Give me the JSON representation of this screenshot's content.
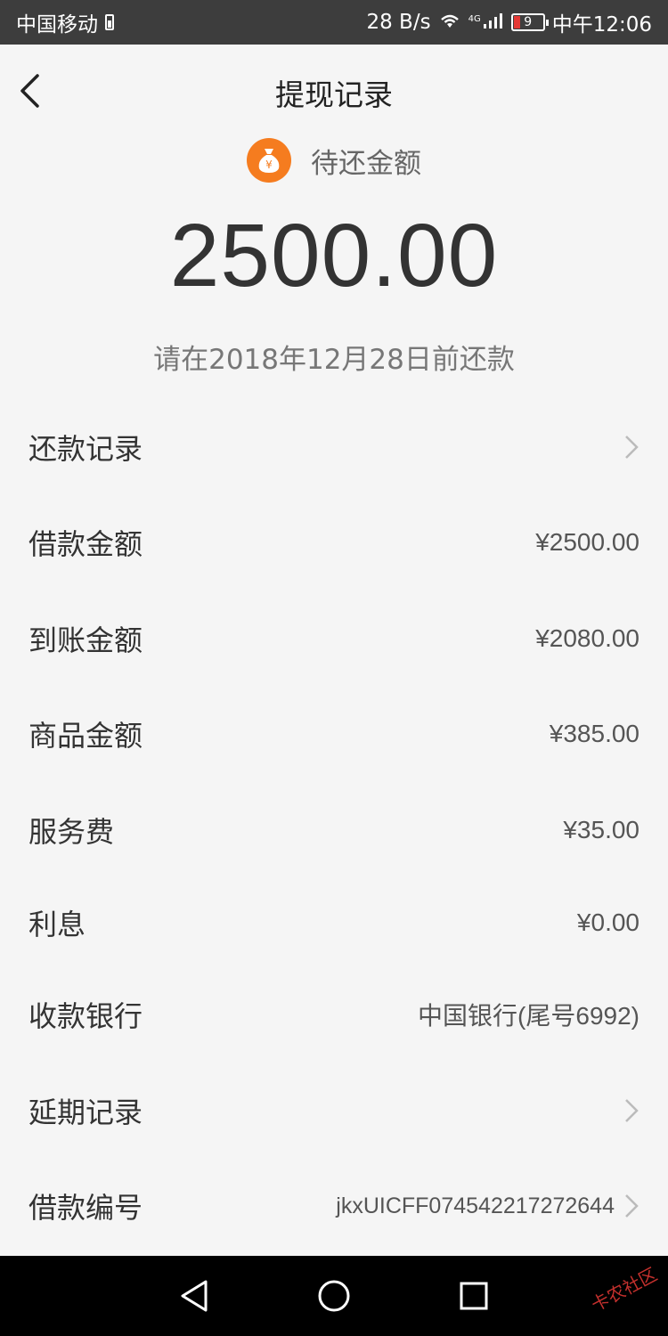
{
  "status_bar": {
    "carrier": "中国移动",
    "net_speed": "28 B/s",
    "network_type": "4G",
    "battery_level": "9",
    "time": "中午12:06"
  },
  "header": {
    "title": "提现记录"
  },
  "summary": {
    "label": "待还金额",
    "amount": "2500.00",
    "due_note": "请在2018年12月28日前还款",
    "icon": "money-bag-icon",
    "icon_color": "#f57c1f"
  },
  "rows": [
    {
      "label": "还款记录",
      "value": "",
      "chevron": true
    },
    {
      "label": "借款金额",
      "value": "¥2500.00",
      "chevron": false
    },
    {
      "label": "到账金额",
      "value": "¥2080.00",
      "chevron": false
    },
    {
      "label": "商品金额",
      "value": "¥385.00",
      "chevron": false
    },
    {
      "label": "服务费",
      "value": "¥35.00",
      "chevron": false
    },
    {
      "label": "利息",
      "value": "¥0.00",
      "chevron": false
    },
    {
      "label": "收款银行",
      "value": "中国银行(尾号6992)",
      "chevron": false
    },
    {
      "label": "延期记录",
      "value": "",
      "chevron": true
    },
    {
      "label": "借款编号",
      "value": "jkxUICFF074542217272644",
      "chevron": true
    }
  ],
  "watermark": "卡农社区"
}
